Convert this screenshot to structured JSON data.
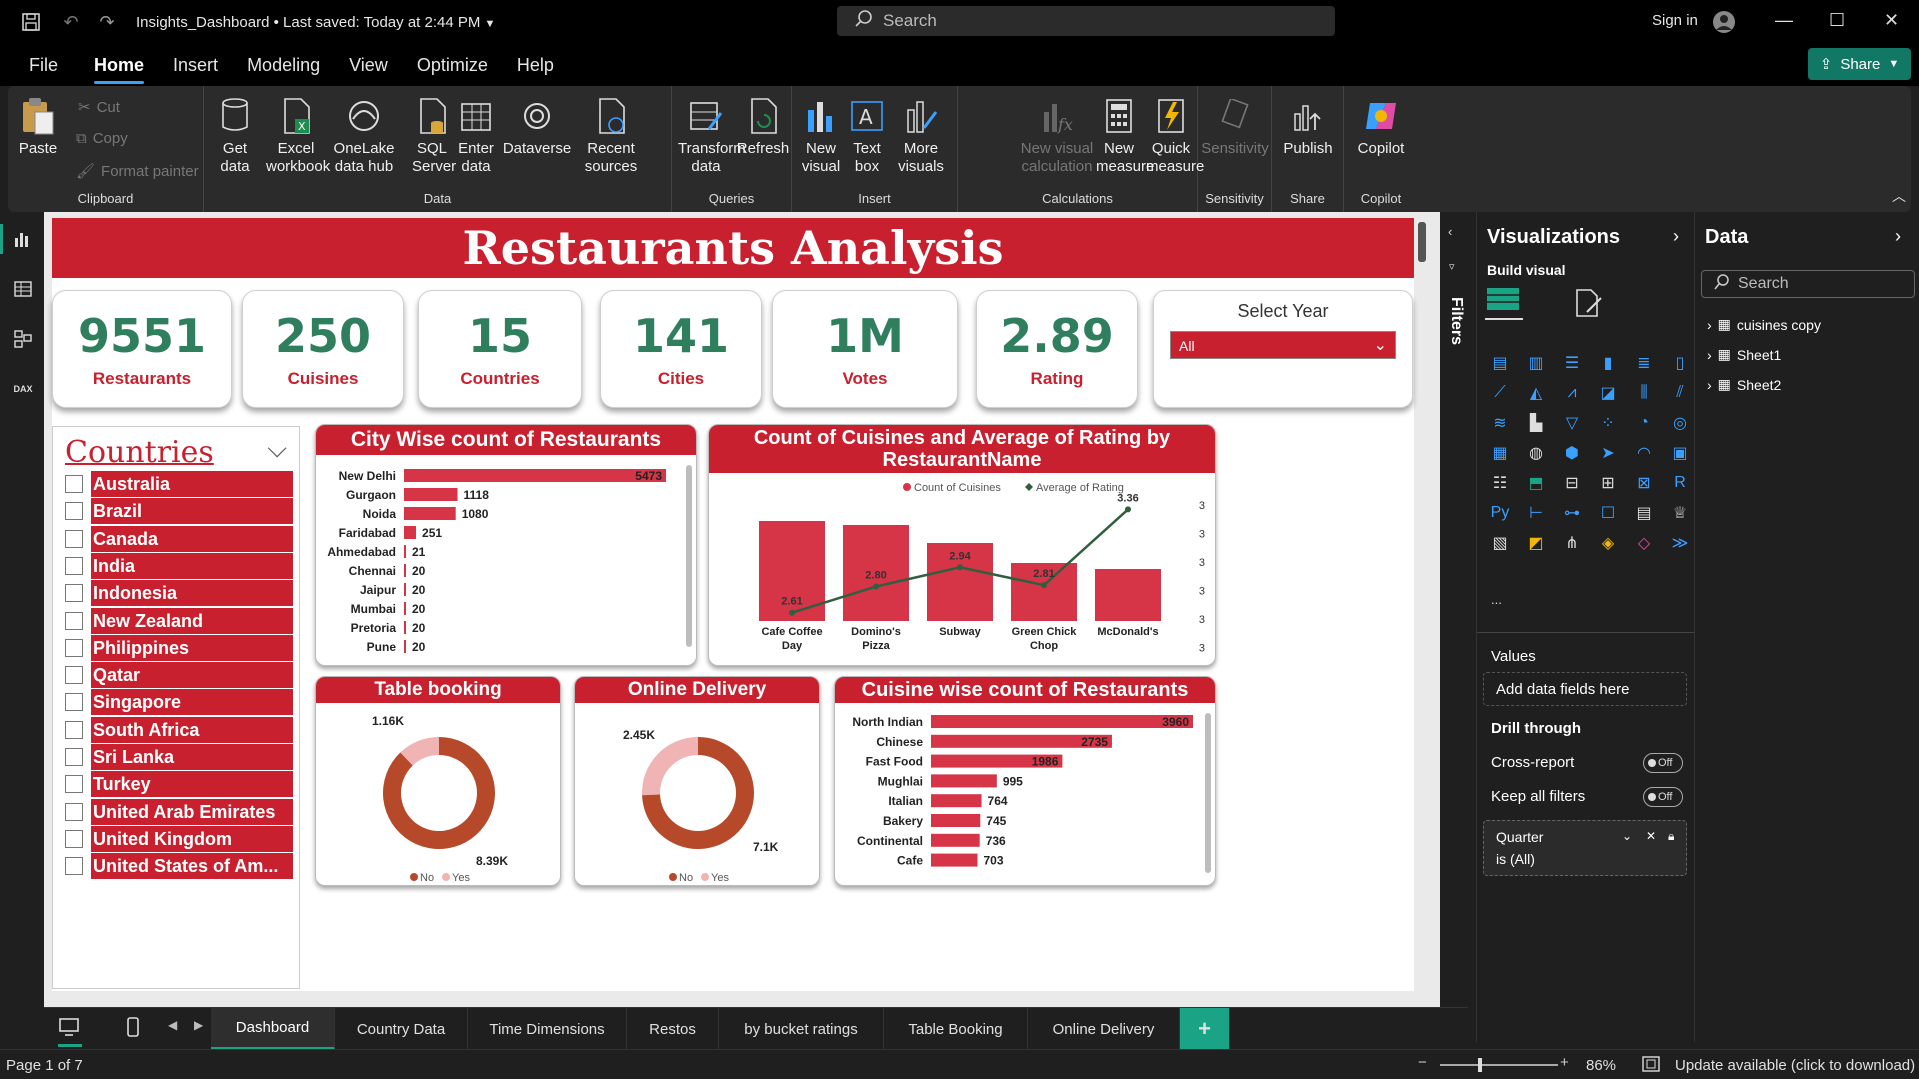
{
  "window": {
    "title": "Insights_Dashboard",
    "saved": "• Last saved: Today at 2:44 PM",
    "search_placeholder": "Search",
    "signin": "Sign in"
  },
  "menu": [
    "File",
    "Home",
    "Insert",
    "Modeling",
    "View",
    "Optimize",
    "Help"
  ],
  "share": "Share",
  "ribbon": {
    "clipboard": {
      "paste": "Paste",
      "cut": "Cut",
      "copy": "Copy",
      "format_painter": "Format painter",
      "label": "Clipboard"
    },
    "data": {
      "get_data": "Get data",
      "excel": "Excel workbook",
      "onelake": "OneLake data hub",
      "sql": "SQL Server",
      "enter": "Enter data",
      "dataverse": "Dataverse",
      "recent": "Recent sources",
      "label": "Data"
    },
    "queries": {
      "transform": "Transform data",
      "refresh": "Refresh",
      "label": "Queries"
    },
    "insert": {
      "new_visual": "New visual",
      "text_box": "Text box",
      "more_visuals": "More visuals",
      "label": "Insert"
    },
    "calculations": {
      "new_visual_calc": "New visual calculation",
      "new_measure": "New measure",
      "quick_measure": "Quick measure",
      "label": "Calculations"
    },
    "sensitivity": {
      "btn": "Sensitivity",
      "label": "Sensitivity"
    },
    "share": {
      "publish": "Publish",
      "label": "Share"
    },
    "copilot": {
      "btn": "Copilot",
      "label": "Copilot"
    }
  },
  "report": {
    "title": "Restaurants Analysis",
    "kpis": [
      {
        "value": "9551",
        "label": "Restaurants"
      },
      {
        "value": "250",
        "label": "Cuisines"
      },
      {
        "value": "15",
        "label": "Countries"
      },
      {
        "value": "141",
        "label": "Cities"
      },
      {
        "value": "1M",
        "label": "Votes"
      },
      {
        "value": "2.89",
        "label": "Rating"
      }
    ],
    "year_slicer": {
      "title": "Select Year",
      "value": "All"
    },
    "countries": {
      "title": "Countries",
      "items": [
        "Australia",
        "Brazil",
        "Canada",
        "India",
        "Indonesia",
        "New Zealand",
        "Philippines",
        "Qatar",
        "Singapore",
        "South Africa",
        "Sri Lanka",
        "Turkey",
        "United Arab Emirates",
        "United Kingdom",
        "United States of Am..."
      ]
    }
  },
  "chart_data": [
    {
      "type": "bar",
      "title": "City Wise count of Restaurants",
      "orientation": "horizontal",
      "categories": [
        "New Delhi",
        "Gurgaon",
        "Noida",
        "Faridabad",
        "Ahmedabad",
        "Chennai",
        "Jaipur",
        "Mumbai",
        "Pretoria",
        "Pune"
      ],
      "values": [
        5473,
        1118,
        1080,
        251,
        21,
        20,
        20,
        20,
        20,
        20
      ],
      "data_labels": [
        "5473",
        "1118",
        "1080",
        "251",
        "21",
        "20",
        "20",
        "20",
        "20",
        "20"
      ],
      "color": "#d63447"
    },
    {
      "type": "bar",
      "title": "Count of Cuisines and Average of Rating by RestaurantName",
      "categories": [
        "Cafe Coffee Day",
        "Domino's Pizza",
        "Subway",
        "Green Chick Chop",
        "McDonald's"
      ],
      "series": [
        {
          "name": "Count of Cuisines",
          "type": "bar",
          "values": [
            3,
            3,
            3,
            3,
            3
          ],
          "color": "#d63447"
        },
        {
          "name": "Average of Rating",
          "type": "line",
          "values": [
            2.61,
            2.8,
            2.94,
            2.81,
            3.36
          ],
          "data_labels": [
            "2.61",
            "2.80",
            "2.94",
            "2.81",
            "3.36"
          ],
          "color": "#2f5f3f"
        }
      ],
      "right_axis_ticks": [
        "3",
        "3",
        "3",
        "3",
        "3",
        "3"
      ],
      "legend": "top-center"
    },
    {
      "type": "pie",
      "title": "Table booking",
      "donut": true,
      "categories": [
        "No",
        "Yes"
      ],
      "values": [
        8390,
        1160
      ],
      "data_labels": [
        "8.39K",
        "1.16K"
      ],
      "colors": [
        "#b5492a",
        "#f0b4b4"
      ]
    },
    {
      "type": "pie",
      "title": "Online Delivery",
      "donut": true,
      "categories": [
        "No",
        "Yes"
      ],
      "values": [
        7100,
        2450
      ],
      "data_labels": [
        "7.1K",
        "2.45K"
      ],
      "colors": [
        "#b5492a",
        "#f0b4b4"
      ]
    },
    {
      "type": "bar",
      "title": "Cuisine wise count of Restaurants",
      "orientation": "horizontal",
      "categories": [
        "North Indian",
        "Chinese",
        "Fast Food",
        "Mughlai",
        "Italian",
        "Bakery",
        "Continental",
        "Cafe"
      ],
      "values": [
        3960,
        2735,
        1986,
        995,
        764,
        745,
        736,
        703
      ],
      "data_labels": [
        "3960",
        "2735",
        "1986",
        "995",
        "764",
        "745",
        "736",
        "703"
      ],
      "color": "#d63447"
    }
  ],
  "filters_label": "Filters",
  "visualizations": {
    "title": "Visualizations",
    "build": "Build visual",
    "values": "Values",
    "add_fields": "Add data fields here",
    "drill": "Drill through",
    "cross_report": "Cross-report",
    "keep_filters": "Keep all filters",
    "toggle_off": "Off",
    "filter_name": "Quarter",
    "filter_value": "is (All)",
    "more": "..."
  },
  "data_pane": {
    "title": "Data",
    "search": "Search",
    "tables": [
      "cuisines copy",
      "Sheet1",
      "Sheet2"
    ]
  },
  "tabs": [
    "Dashboard",
    "Country Data",
    "Time Dimensions",
    "Restos",
    "by bucket ratings",
    "Table Booking",
    "Online Delivery"
  ],
  "status": {
    "page": "Page 1 of 7",
    "zoom": "86%",
    "update": "Update available (click to download)"
  }
}
